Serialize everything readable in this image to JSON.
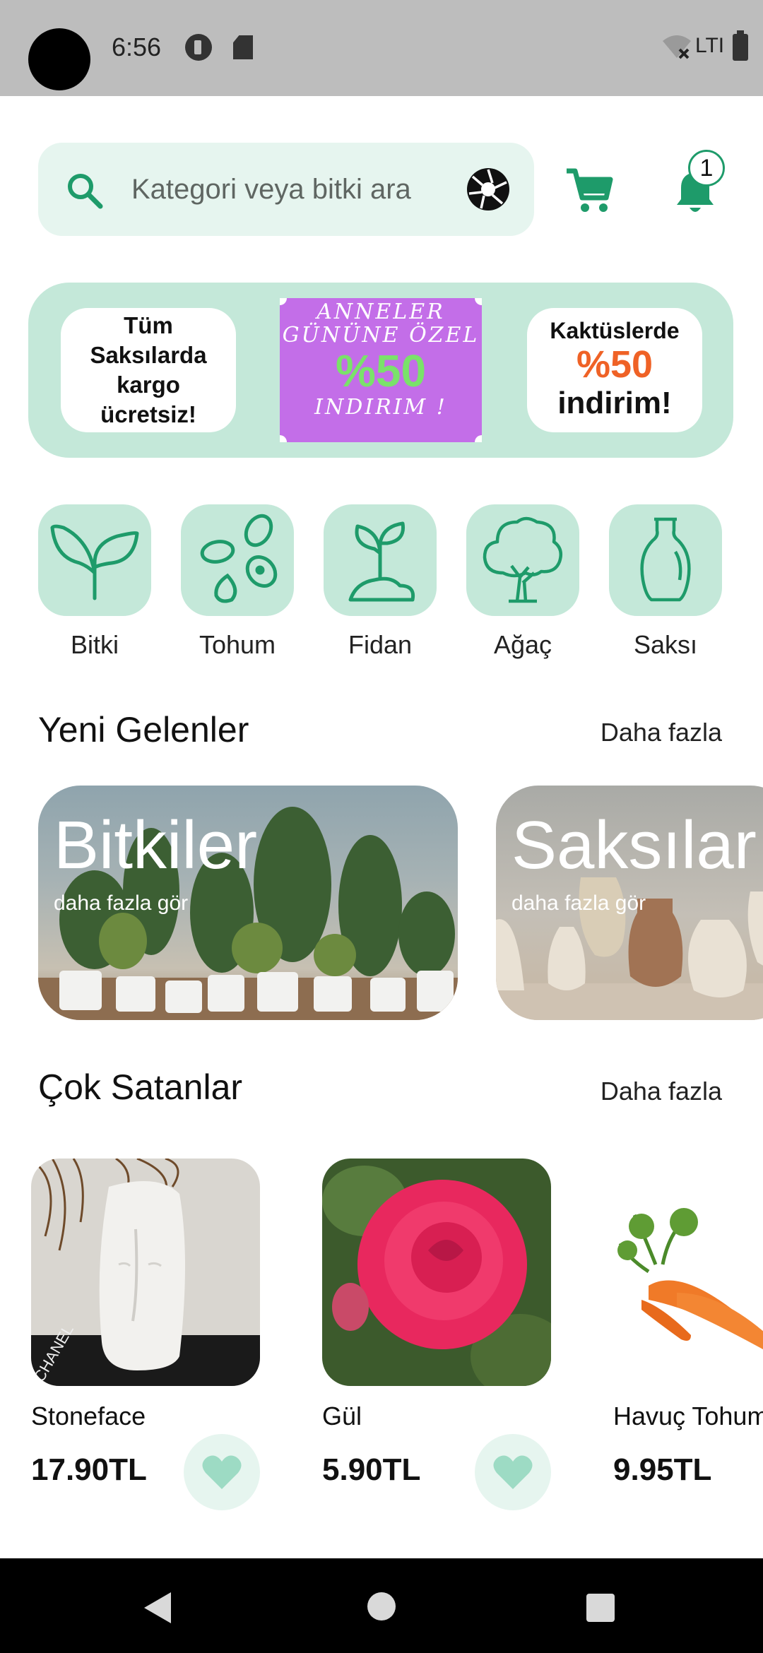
{
  "status_bar": {
    "time": "6:56",
    "network": "LTI"
  },
  "search": {
    "placeholder": "Kategori veya bitki ara"
  },
  "notifications": {
    "badge_count": "1"
  },
  "promo": {
    "left_text": "Tüm Saksılarda kargo ücretsiz!",
    "center_line1": "ANNELER",
    "center_line2": "GÜNÜNE ÖZEL",
    "center_line3": "%50",
    "center_line4": "INDIRIM !",
    "right_line1": "Kaktüslerde",
    "right_line2": "%50",
    "right_line3": "indirim!"
  },
  "categories": [
    {
      "label": "Bitki",
      "icon": "plant-icon"
    },
    {
      "label": "Tohum",
      "icon": "seeds-icon"
    },
    {
      "label": "Fidan",
      "icon": "sapling-icon"
    },
    {
      "label": "Ağaç",
      "icon": "tree-icon"
    },
    {
      "label": "Saksı",
      "icon": "vase-icon"
    }
  ],
  "new_arrivals": {
    "title": "Yeni Gelenler",
    "more": "Daha fazla",
    "cards": [
      {
        "title": "Bitkiler",
        "subtitle": "daha fazla gör"
      },
      {
        "title": "Saksılar",
        "subtitle": "daha fazla gör"
      }
    ]
  },
  "best_sellers": {
    "title": "Çok Satanlar",
    "more": "Daha fazla",
    "products": [
      {
        "name": "Stoneface",
        "price": "17.90TL"
      },
      {
        "name": "Gül",
        "price": "5.90TL"
      },
      {
        "name": "Havuç Tohumu",
        "price": "9.95TL"
      }
    ]
  },
  "colors": {
    "accent": "#1e9b6a",
    "tile": "#c4e8d9",
    "search_bg": "#e6f5ef",
    "promo_orange": "#ef6226",
    "promo_purple": "#c36ee8"
  }
}
